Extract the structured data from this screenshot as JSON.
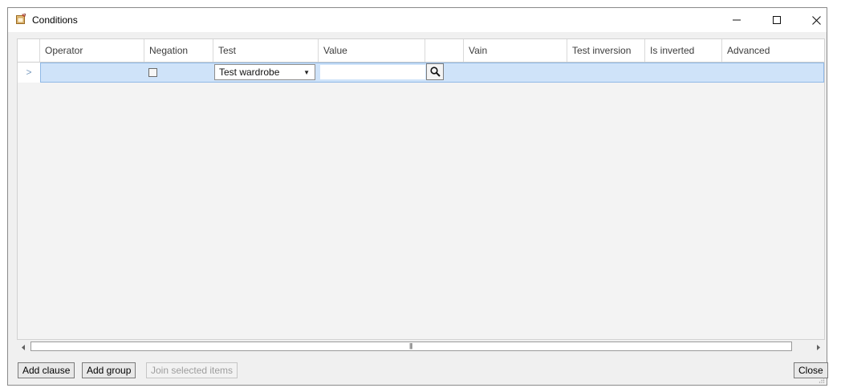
{
  "window": {
    "title": "Conditions",
    "icon": "app-icon",
    "controls": {
      "minimize": "minimize-icon",
      "maximize": "maximize-icon",
      "close": "close-icon"
    }
  },
  "grid": {
    "columns": [
      {
        "label": ""
      },
      {
        "label": "Operator"
      },
      {
        "label": "Negation"
      },
      {
        "label": "Test"
      },
      {
        "label": "Value"
      },
      {
        "label": ""
      },
      {
        "label": "Vain"
      },
      {
        "label": "Test inversion"
      },
      {
        "label": "Is inverted"
      },
      {
        "label": "Advanced"
      }
    ],
    "row": {
      "indicator": ">",
      "negation_checked": false,
      "test_value": "Test wardrobe",
      "value": ""
    },
    "selection_color": "#cfe3f9"
  },
  "scrollbar": {
    "grip": "|||"
  },
  "buttons": {
    "add_clause": "Add clause",
    "add_group": "Add group",
    "join_selected": "Join selected items",
    "close": "Close"
  }
}
